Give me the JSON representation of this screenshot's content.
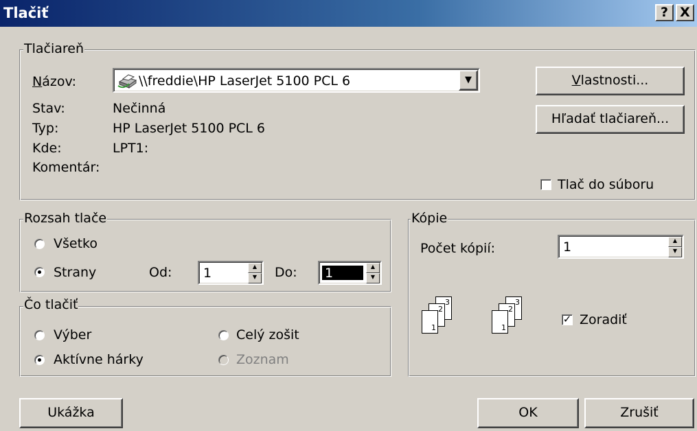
{
  "window": {
    "title": "Tlačiť",
    "help_label": "?",
    "close_label": "X"
  },
  "printer": {
    "legend": "Tlačiareň",
    "name_label": "Názov:",
    "name_value": "\\\\freddie\\HP LaserJet 5100 PCL 6",
    "status_label": "Stav:",
    "status_value": "Nečinná",
    "type_label": "Typ:",
    "type_value": "HP LaserJet 5100 PCL 6",
    "where_label": "Kde:",
    "where_value": "LPT1:",
    "comment_label": "Komentár:",
    "properties_button": "Vlastnosti...",
    "find_printer_button": "Hľadať tlačiareň...",
    "print_to_file_label": "Tlač do súboru",
    "print_to_file_checked": false
  },
  "range": {
    "legend": "Rozsah tlače",
    "all_label": "Všetko",
    "pages_label": "Strany",
    "selected": "pages",
    "from_label": "Od:",
    "from_value": "1",
    "to_label": "Do:",
    "to_value": "1"
  },
  "what": {
    "legend": "Čo tlačiť",
    "selection_label": "Výber",
    "workbook_label": "Celý zošit",
    "active_sheets_label": "Aktívne hárky",
    "list_label": "Zoznam",
    "selected": "active_sheets"
  },
  "copies": {
    "legend": "Kópie",
    "count_label": "Počet kópií:",
    "count_value": "1",
    "collate_label": "Zoradiť",
    "collate_checked": true,
    "page_numbers": [
      "1",
      "2",
      "3"
    ]
  },
  "buttons": {
    "preview": "Ukážka",
    "ok": "OK",
    "cancel": "Zrušiť"
  },
  "colors": {
    "face": "#d4d0c8",
    "title_start": "#0a246a",
    "title_end": "#a6caf0",
    "disabled_text": "#808080"
  }
}
